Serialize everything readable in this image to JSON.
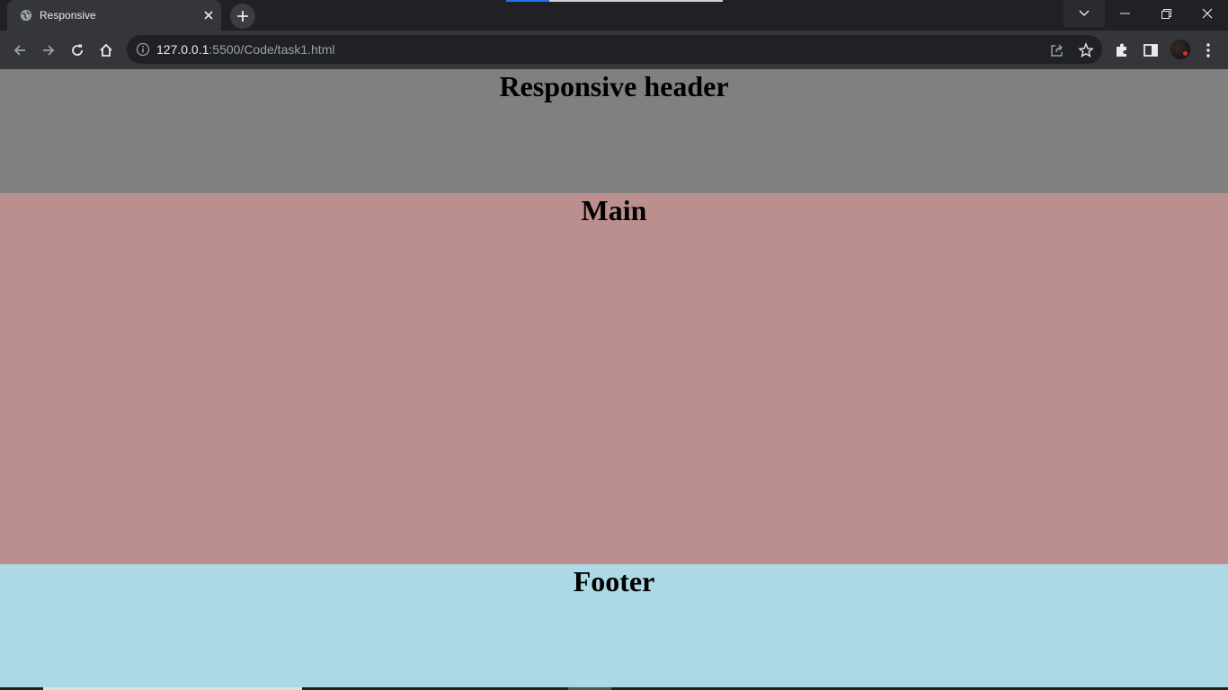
{
  "browser": {
    "tab": {
      "title": "Responsive",
      "favicon": "globe-icon"
    },
    "new_tab_icon": "plus-icon",
    "window_controls": [
      "chevron-down-icon",
      "minimize-icon",
      "restore-icon",
      "close-icon"
    ],
    "address_bar": {
      "host": "127.0.0.1",
      "path": ":5500/Code/task1.html",
      "info_icon": "info-icon"
    },
    "toolbar_icons": [
      "back-arrow-icon",
      "forward-arrow-icon",
      "reload-icon",
      "home-icon",
      "share-icon",
      "star-icon",
      "extensions-icon",
      "side-panel-icon",
      "profile-avatar",
      "kebab-menu-icon"
    ]
  },
  "page": {
    "header": {
      "title": "Responsive header",
      "background": "#808080"
    },
    "main": {
      "title": "Main",
      "background": "#bc8f8f"
    },
    "footer": {
      "title": "Footer",
      "background": "#add8e6"
    }
  },
  "colors": {
    "chrome_dark": "#202124",
    "chrome_toolbar": "#35363a",
    "text_light": "#e8eaed",
    "text_muted": "#9aa0a6"
  }
}
